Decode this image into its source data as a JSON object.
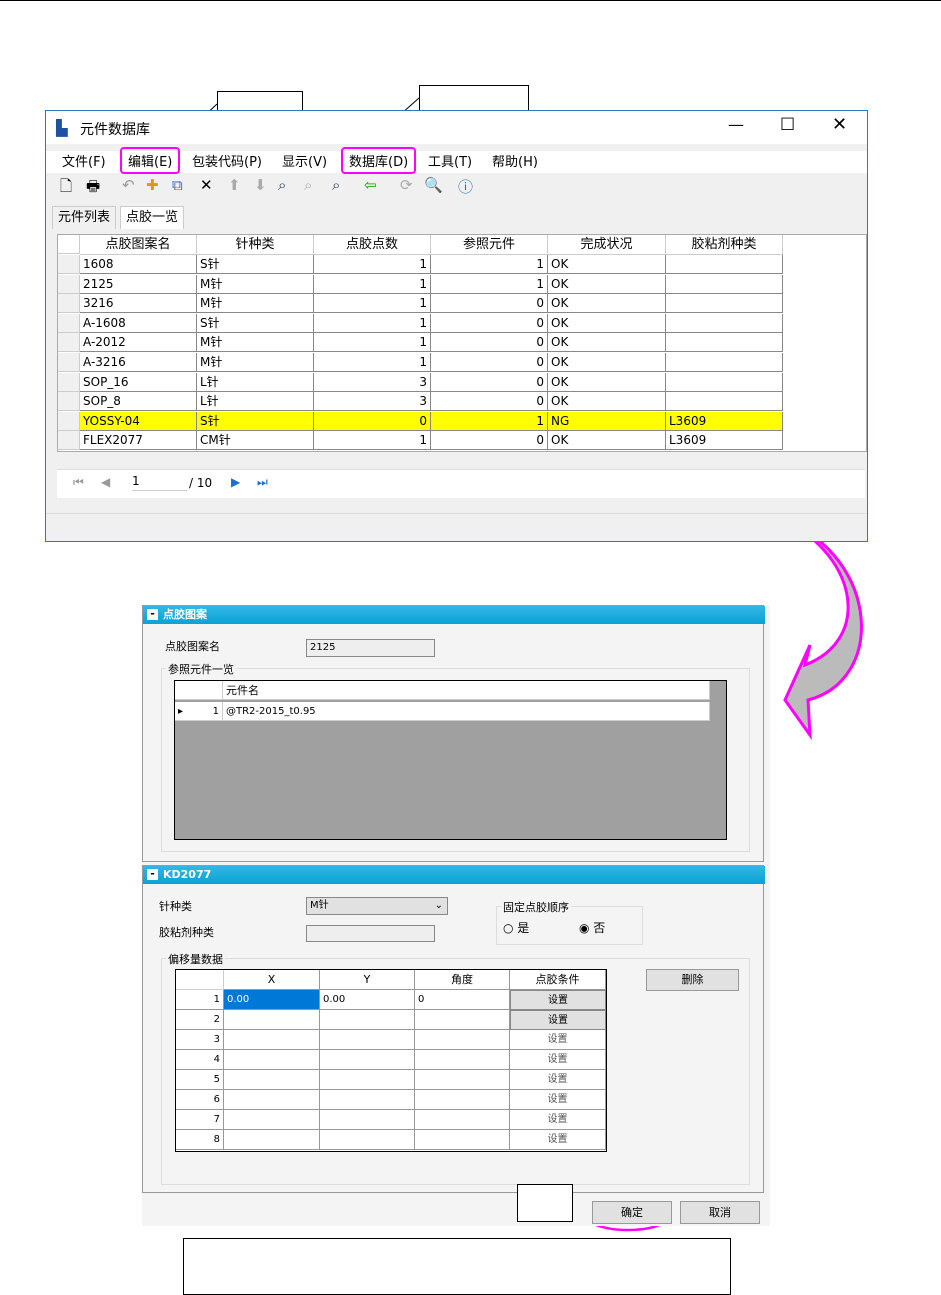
{
  "window": {
    "title": "元件数据库",
    "menu": [
      "文件(F)",
      "编辑(E)",
      "包装代码(P)",
      "显示(V)",
      "数据库(D)",
      "工具(T)",
      "帮助(H)"
    ],
    "tabs": [
      "元件列表",
      "点胶一览"
    ],
    "columns": [
      "点胶图案名",
      "针种类",
      "点胶点数",
      "参照元件",
      "完成状况",
      "胶粘剂种类"
    ],
    "rows": [
      [
        "1608",
        "S针",
        "1",
        "1",
        "OK",
        ""
      ],
      [
        "2125",
        "M针",
        "1",
        "1",
        "OK",
        ""
      ],
      [
        "3216",
        "M针",
        "1",
        "0",
        "OK",
        ""
      ],
      [
        "A-1608",
        "S针",
        "1",
        "0",
        "OK",
        ""
      ],
      [
        "A-2012",
        "M针",
        "1",
        "0",
        "OK",
        ""
      ],
      [
        "A-3216",
        "M针",
        "1",
        "0",
        "OK",
        ""
      ],
      [
        "SOP_16",
        "L针",
        "3",
        "0",
        "OK",
        ""
      ],
      [
        "SOP_8",
        "L针",
        "3",
        "0",
        "OK",
        ""
      ],
      [
        "YOSSY-04",
        "S针",
        "0",
        "1",
        "NG",
        "L3609"
      ],
      [
        "FLEX2077",
        "CM针",
        "1",
        "0",
        "OK",
        "L3609"
      ]
    ],
    "highlight_row": 8,
    "highlight_color": "#ffff00",
    "pager": {
      "page": "1",
      "total": "/ 10"
    }
  },
  "dialog": {
    "panel1": {
      "title": "点胶图案",
      "name_label": "点胶图案名",
      "name_value": "2125",
      "ref_group": "参照元件一览",
      "ref_header": "元件名",
      "ref_rows": [
        [
          "1",
          "@TR2-2015_t0.95"
        ]
      ]
    },
    "panel2": {
      "title": "KD2077",
      "needle_label": "针种类",
      "needle_value": "M针",
      "adhesive_label": "胶粘剂种类",
      "adhesive_value": "",
      "order_group": "固定点胶顺序",
      "opt_yes": "是",
      "opt_no": "否",
      "selected": "否",
      "offset_group": "偏移量数据",
      "delete_label": "删除",
      "columns": [
        "X",
        "Y",
        "角度",
        "点胶条件"
      ],
      "set_label": "设置",
      "rows": [
        [
          "1",
          "0.00",
          "0.00",
          "0"
        ],
        [
          "2",
          "",
          "",
          ""
        ],
        [
          "3",
          "",
          "",
          ""
        ],
        [
          "4",
          "",
          "",
          ""
        ],
        [
          "5",
          "",
          "",
          ""
        ],
        [
          "6",
          "",
          "",
          ""
        ],
        [
          "7",
          "",
          "",
          ""
        ],
        [
          "8",
          "",
          "",
          ""
        ]
      ]
    },
    "ok_label": "确定",
    "cancel_label": "取消"
  },
  "accent": "#ff00ff"
}
